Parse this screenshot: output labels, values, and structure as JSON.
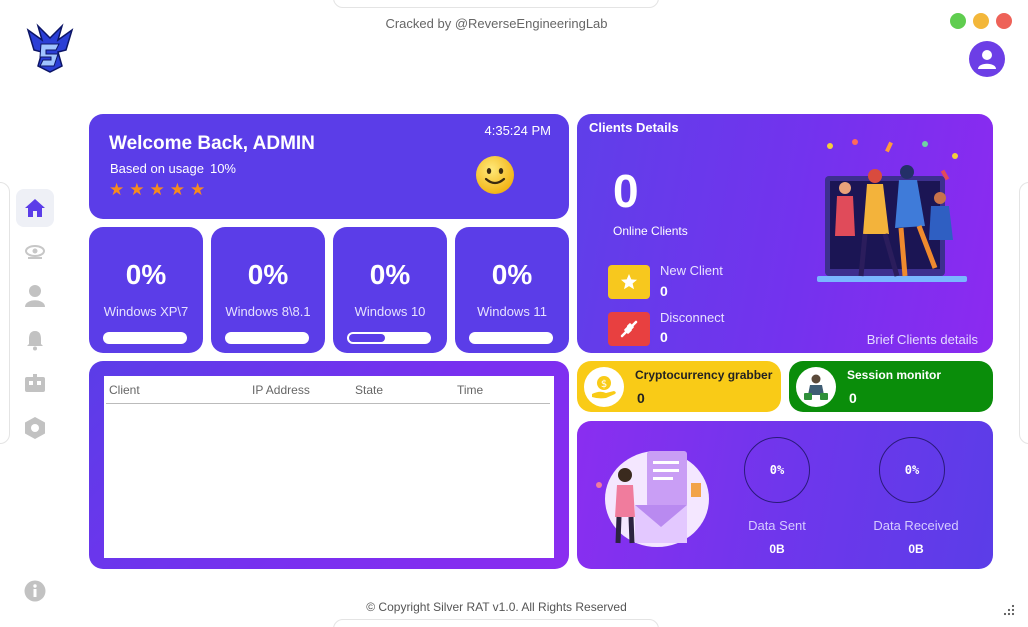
{
  "header": {
    "cracked_text": "Cracked by @ReverseEngineeringLab"
  },
  "window_controls": {
    "colors": [
      "#5fcd4f",
      "#f3b73a",
      "#ee6258"
    ]
  },
  "sidebar": {
    "items": [
      {
        "icon": "home-icon",
        "active": true
      },
      {
        "icon": "eye-icon",
        "active": false
      },
      {
        "icon": "user-icon",
        "active": false
      },
      {
        "icon": "bell-icon",
        "active": false
      },
      {
        "icon": "robot-icon",
        "active": false
      },
      {
        "icon": "hexagon-settings-icon",
        "active": false
      }
    ]
  },
  "welcome": {
    "title": "Welcome Back, ADMIN",
    "usage_label": "Based on usage",
    "usage_pct": "10%",
    "time": "4:35:24 PM",
    "rating_stars": 5
  },
  "os_stats": [
    {
      "pct": "0%",
      "name": "Windows XP\\7",
      "fill": 0
    },
    {
      "pct": "0%",
      "name": "Windows 8\\8.1",
      "fill": 0
    },
    {
      "pct": "0%",
      "name": "Windows 10",
      "fill": 0.45
    },
    {
      "pct": "0%",
      "name": "Windows 11",
      "fill": 0
    }
  ],
  "clients_table": {
    "columns": [
      "Client",
      "IP Address",
      "State",
      "Time"
    ],
    "rows": []
  },
  "clients_details": {
    "title": "Clients Details",
    "online_count": "0",
    "online_label": "Online Clients",
    "new_client_label": "New Client",
    "new_client_value": "0",
    "disconnect_label": "Disconnect",
    "disconnect_value": "0",
    "brief_label": "Brief Clients details"
  },
  "crypto_grabber": {
    "title": "Cryptocurrency grabber",
    "value": "0"
  },
  "session_monitor": {
    "title": "Session monitor",
    "value": "0"
  },
  "data_transfer": {
    "sent_pct": "0%",
    "sent_label": "Data Sent",
    "sent_value": "0B",
    "received_pct": "0%",
    "received_label": "Data Received",
    "received_value": "0B"
  },
  "footer": {
    "copyright": "© Copyright Silver RAT v1.0.  All Rights Reserved"
  }
}
